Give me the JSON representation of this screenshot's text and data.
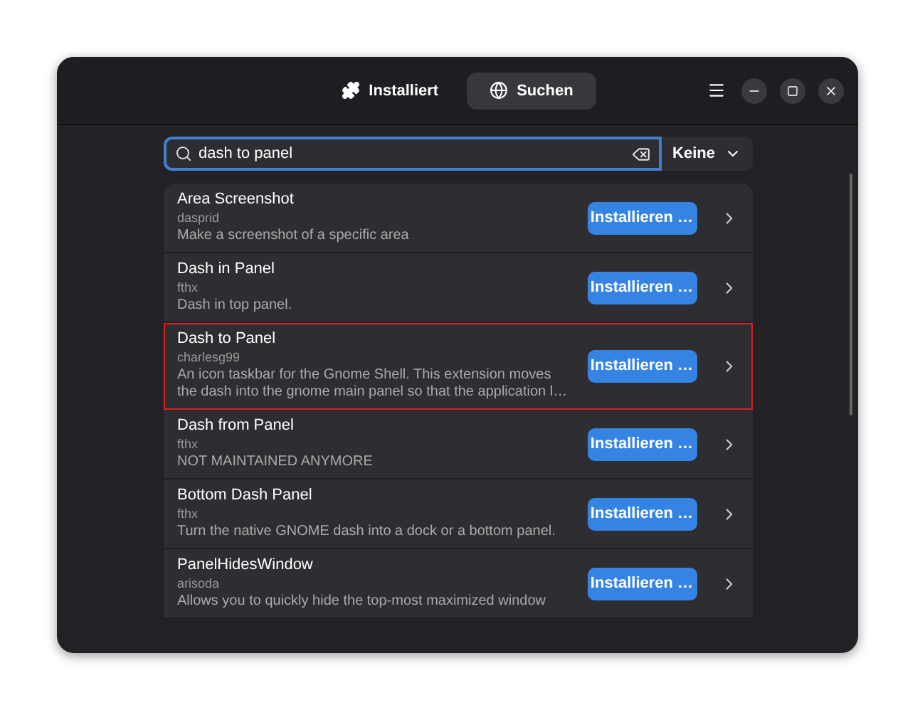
{
  "header": {
    "tabs": [
      {
        "label": "Installiert",
        "selected": false
      },
      {
        "label": "Suchen",
        "selected": true
      }
    ]
  },
  "search": {
    "value": "dash to panel",
    "filter": "Keine"
  },
  "results": [
    {
      "name": "Area Screenshot",
      "author": "dasprid",
      "description": "Make a screenshot of a specific area",
      "button": "Installieren …",
      "highlighted": false
    },
    {
      "name": "Dash in Panel",
      "author": "fthx",
      "description": "Dash in top panel.",
      "button": "Installieren …",
      "highlighted": false
    },
    {
      "name": "Dash to Panel",
      "author": "charlesg99",
      "description": "An icon taskbar for the Gnome Shell. This extension moves the dash into the gnome main panel so that the application l…",
      "button": "Installieren …",
      "highlighted": true
    },
    {
      "name": "Dash from Panel",
      "author": "fthx",
      "description": "NOT MAINTAINED ANYMORE",
      "button": "Installieren …",
      "highlighted": false
    },
    {
      "name": "Bottom Dash Panel",
      "author": "fthx",
      "description": "Turn the native GNOME dash into a dock or a bottom panel.",
      "button": "Installieren …",
      "highlighted": false
    },
    {
      "name": "PanelHidesWindow",
      "author": "arisoda",
      "description": "Allows you to quickly hide the top-most maximized window",
      "button": "Installieren …",
      "highlighted": false
    }
  ]
}
